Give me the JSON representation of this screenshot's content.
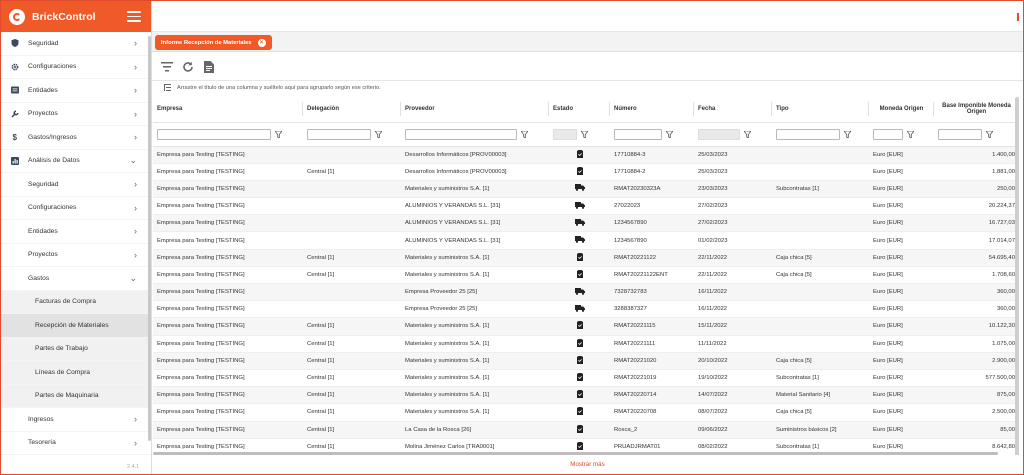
{
  "app": {
    "name": "BrickControl",
    "version": "2.4.1"
  },
  "sidebar": {
    "items": [
      {
        "label": "Seguridad",
        "icon": "shield-icon",
        "level": 0
      },
      {
        "label": "Configuraciones",
        "icon": "gear-icon",
        "level": 0
      },
      {
        "label": "Entidades",
        "icon": "list-icon",
        "level": 0
      },
      {
        "label": "Proyectos",
        "icon": "wrench-icon",
        "level": 0
      },
      {
        "label": "Gastos/Ingresos",
        "icon": "dollar-icon",
        "level": 0
      },
      {
        "label": "Análisis de Datos",
        "icon": "chart-icon",
        "level": 0,
        "expanded": true
      },
      {
        "label": "Seguridad",
        "level": 1
      },
      {
        "label": "Configuraciones",
        "level": 1
      },
      {
        "label": "Entidades",
        "level": 1
      },
      {
        "label": "Proyectos",
        "level": 1
      },
      {
        "label": "Gastos",
        "level": 1,
        "expanded": true
      },
      {
        "label": "Facturas de Compra",
        "level": 2
      },
      {
        "label": "Recepción de Materiales",
        "level": 2,
        "active": true
      },
      {
        "label": "Partes de Trabajo",
        "level": 2
      },
      {
        "label": "Líneas de Compra",
        "level": 2
      },
      {
        "label": "Partes de Maquinaria",
        "level": 2
      },
      {
        "label": "Ingresos",
        "level": 1
      },
      {
        "label": "Tesorería",
        "level": 1
      }
    ]
  },
  "tab": {
    "label": "Informe Recepción de Materiales",
    "close": "×"
  },
  "toolbar": {
    "icons": [
      "filter-icon",
      "refresh-icon",
      "document-icon"
    ]
  },
  "grouping_hint": "Arrastre el título de una columna y suéltelo aquí para agruparlo según ese criterio.",
  "table": {
    "columns": [
      "Empresa",
      "Delegación",
      "Proveedor",
      "Estado",
      "Número",
      "Fecha",
      "Tipo",
      "Moneda Origen",
      "Base Imponible Moneda Origen"
    ],
    "rows": [
      [
        "Empresa para Testing [TESTING]",
        "",
        "Desarrollos Informáticos [PROV00003]",
        "doc",
        "17710884-3",
        "25/03/2023",
        "",
        "Euro [EUR]",
        "1.400,00"
      ],
      [
        "Empresa para Testing [TESTING]",
        "Central [1]",
        "Desarrollos Informáticos [PROV00003]",
        "doc",
        "17710884-2",
        "25/03/2023",
        "",
        "Euro [EUR]",
        "1.881,00"
      ],
      [
        "Empresa para Testing [TESTING]",
        "",
        "Materiales y suministros S.A. [1]",
        "truck",
        "RMAT20230323A",
        "23/03/2023",
        "Subcontratas [1]",
        "Euro [EUR]",
        "250,00"
      ],
      [
        "Empresa para Testing [TESTING]",
        "",
        "ALUMINIOS Y VERANDAS S.L. [31]",
        "truck",
        "27022023",
        "27/02/2023",
        "",
        "Euro [EUR]",
        "20.224,37"
      ],
      [
        "Empresa para Testing [TESTING]",
        "",
        "ALUMINIOS Y VERANDAS S.L. [31]",
        "truck",
        "1234567890",
        "27/02/2023",
        "",
        "Euro [EUR]",
        "16.727,03"
      ],
      [
        "Empresa para Testing [TESTING]",
        "",
        "ALUMINIOS Y VERANDAS S.L. [31]",
        "truck",
        "1234567890",
        "01/02/2023",
        "",
        "Euro [EUR]",
        "17.014,07"
      ],
      [
        "Empresa para Testing [TESTING]",
        "Central [1]",
        "Materiales y suministros S.A. [1]",
        "doc",
        "RMAT20221122",
        "22/11/2022",
        "Caja chica [5]",
        "Euro [EUR]",
        "54.695,40"
      ],
      [
        "Empresa para Testing [TESTING]",
        "Central [1]",
        "Materiales y suministros S.A. [1]",
        "doc",
        "RMAT20221122ENT",
        "22/11/2022",
        "Caja chica [5]",
        "Euro [EUR]",
        "1.708,60"
      ],
      [
        "Empresa para Testing [TESTING]",
        "",
        "Empresa Proveedor 25 [25]",
        "truck",
        "7328732783",
        "16/11/2022",
        "",
        "Euro [EUR]",
        "360,00"
      ],
      [
        "Empresa para Testing [TESTING]",
        "",
        "Empresa Proveedor 25 [25]",
        "truck",
        "3288387327",
        "16/11/2022",
        "",
        "Euro [EUR]",
        "360,00"
      ],
      [
        "Empresa para Testing [TESTING]",
        "Central [1]",
        "Materiales y suministros S.A. [1]",
        "doc",
        "RMAT20221115",
        "15/11/2022",
        "",
        "Euro [EUR]",
        "10.122,30"
      ],
      [
        "Empresa para Testing [TESTING]",
        "Central [1]",
        "Materiales y suministros S.A. [1]",
        "doc",
        "RMAT20221111",
        "11/11/2022",
        "",
        "Euro [EUR]",
        "1.075,00"
      ],
      [
        "Empresa para Testing [TESTING]",
        "Central [1]",
        "Materiales y suministros S.A. [1]",
        "doc",
        "RMAT20221020",
        "20/10/2022",
        "Caja chica [5]",
        "Euro [EUR]",
        "2.900,00"
      ],
      [
        "Empresa para Testing [TESTING]",
        "Central [1]",
        "Materiales y suministros S.A. [1]",
        "doc",
        "RMAT20221019",
        "19/10/2022",
        "Subcontratas [1]",
        "Euro [EUR]",
        "577.500,00"
      ],
      [
        "Empresa para Testing [TESTING]",
        "Central [1]",
        "Materiales y suministros S.A. [1]",
        "doc",
        "RMAT20220714",
        "14/07/2022",
        "Material Sanitario [4]",
        "Euro [EUR]",
        "875,00"
      ],
      [
        "Empresa para Testing [TESTING]",
        "Central [1]",
        "Materiales y suministros S.A. [1]",
        "doc",
        "RMAT20220708",
        "08/07/2022",
        "Caja chica [5]",
        "Euro [EUR]",
        "2.500,00"
      ],
      [
        "Empresa para Testing [TESTING]",
        "Central [1]",
        "La Casa de la Rosca [26]",
        "doc",
        "Rosca_2",
        "09/06/2022",
        "Suministros básicos [2]",
        "Euro [EUR]",
        "85,00"
      ],
      [
        "Empresa para Testing [TESTING]",
        "Central [1]",
        "Molina Jiménez Carlos [TRA0001]",
        "doc",
        "PRUADJRMAT01",
        "08/02/2022",
        "Subcontratas [1]",
        "Euro [EUR]",
        "8.642,80"
      ]
    ]
  },
  "footer": {
    "more": "Mostrar más"
  }
}
